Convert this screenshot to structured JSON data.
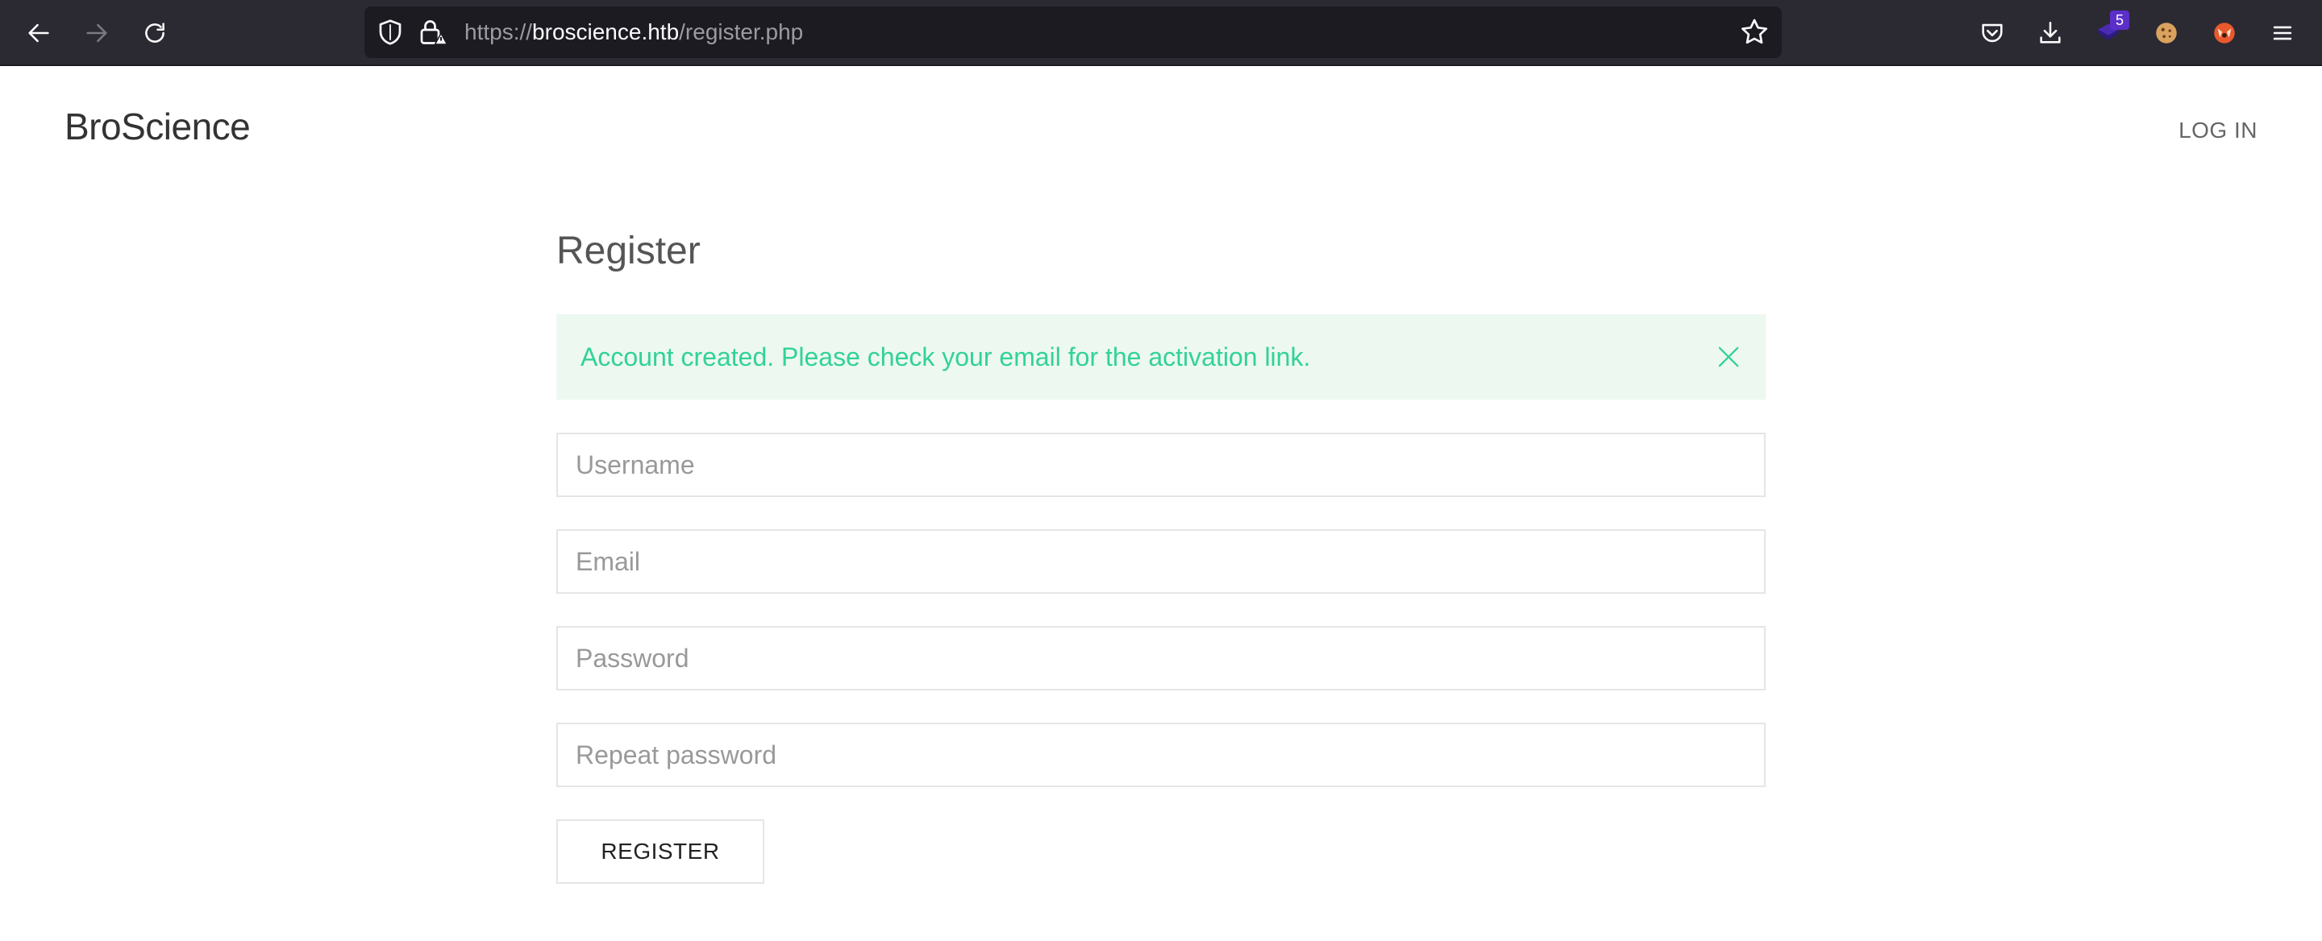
{
  "browser": {
    "url_scheme": "https://",
    "url_host": "broscience.htb",
    "url_path": "/register.php",
    "extension_badge": "5",
    "icons": {
      "back": "back-arrow-icon",
      "forward": "forward-arrow-icon",
      "reload": "reload-icon",
      "shield": "tracking-protection-shield-icon",
      "lock": "insecure-lock-icon",
      "bookmark": "star-icon",
      "pocket": "pocket-icon",
      "downloads": "download-icon",
      "extension": "extension-icon",
      "cookie": "cookie-icon",
      "fox": "fox-icon",
      "menu": "hamburger-menu-icon"
    }
  },
  "header": {
    "brand": "BroScience",
    "login_label": "LOG IN"
  },
  "main": {
    "title": "Register",
    "alert": {
      "message": "Account created. Please check your email for the activation link.",
      "type": "success",
      "color": "#32d296",
      "background": "#edf8f1"
    },
    "form": {
      "username_placeholder": "Username",
      "email_placeholder": "Email",
      "password_placeholder": "Password",
      "repeat_password_placeholder": "Repeat password",
      "submit_label": "REGISTER"
    }
  },
  "colors": {
    "toolbar_bg": "#2b2a33",
    "urlbar_bg": "#1c1b22",
    "success": "#32d296"
  }
}
